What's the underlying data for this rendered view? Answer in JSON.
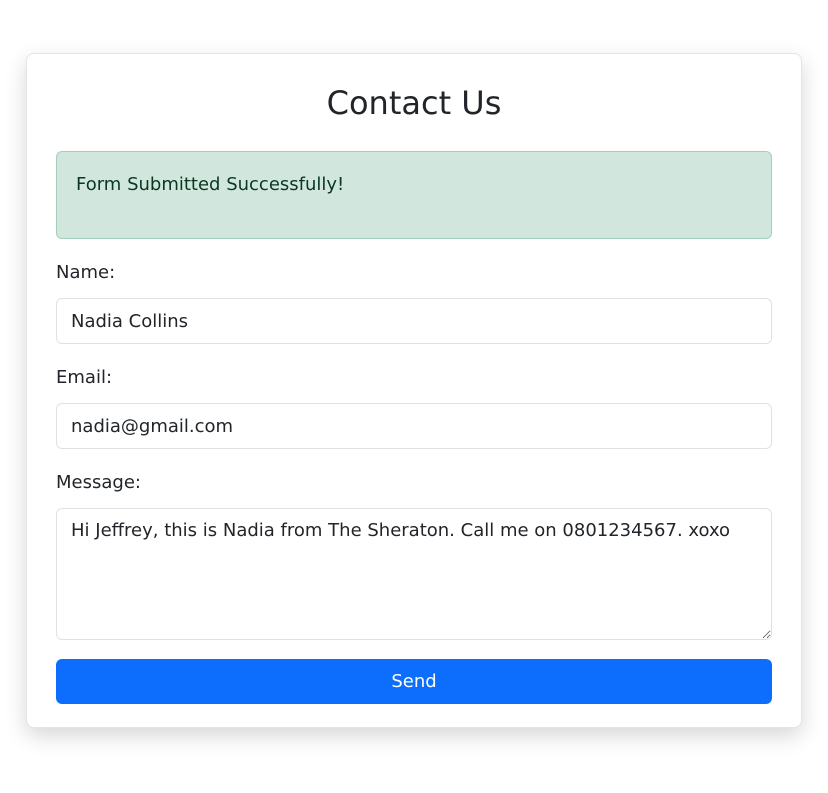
{
  "form": {
    "title": "Contact Us",
    "alert_text": "Form Submitted Successfully!",
    "name_label": "Name:",
    "name_value": "Nadia Collins",
    "email_label": "Email:",
    "email_value": "nadia@gmail.com",
    "message_label": "Message:",
    "message_value": "Hi Jeffrey, this is Nadia from The Sheraton. Call me on 0801234567. xoxo",
    "send_label": "Send"
  },
  "colors": {
    "alert_bg": "#d1e7dd",
    "alert_border": "#a3cfbb",
    "primary_button": "#0d6efd"
  }
}
